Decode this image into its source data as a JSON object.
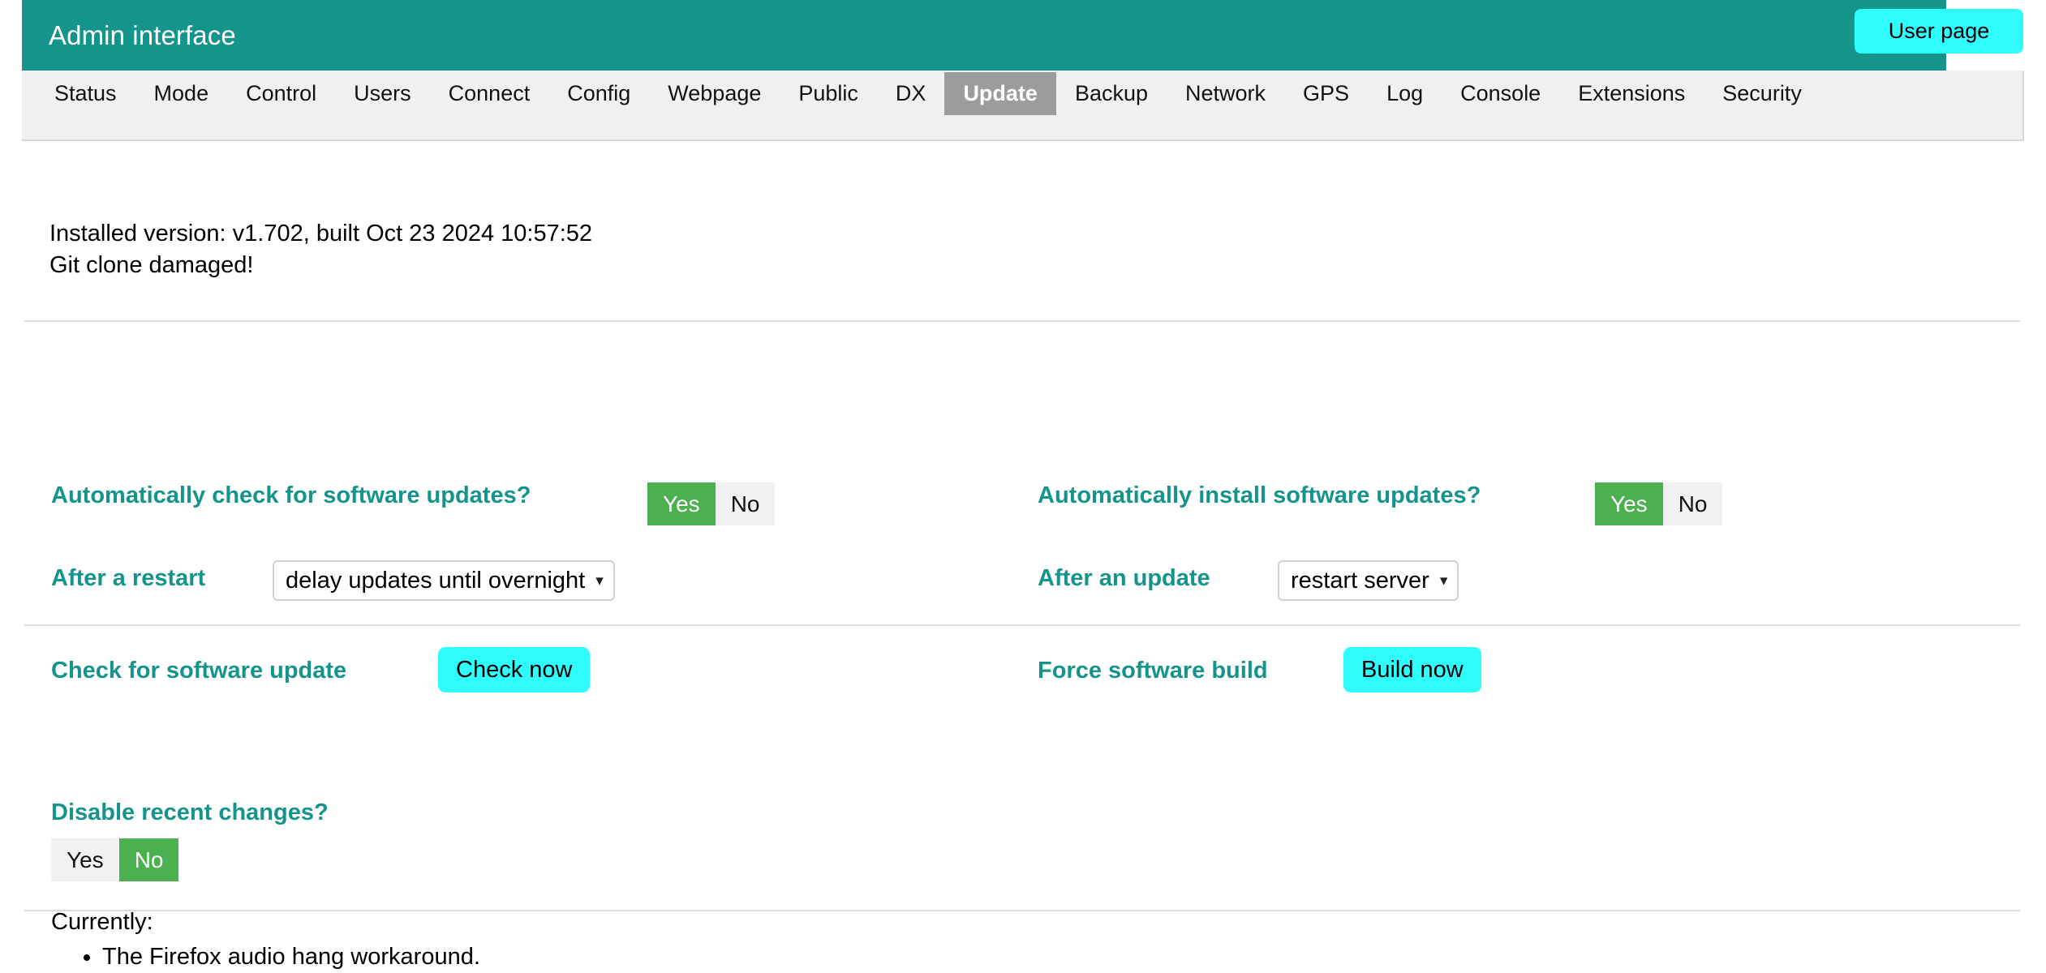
{
  "header": {
    "title": "Admin interface",
    "user_page_label": "User page"
  },
  "nav": {
    "items": [
      {
        "label": "Status",
        "active": false
      },
      {
        "label": "Mode",
        "active": false
      },
      {
        "label": "Control",
        "active": false
      },
      {
        "label": "Users",
        "active": false
      },
      {
        "label": "Connect",
        "active": false
      },
      {
        "label": "Config",
        "active": false
      },
      {
        "label": "Webpage",
        "active": false
      },
      {
        "label": "Public",
        "active": false
      },
      {
        "label": "DX",
        "active": false
      },
      {
        "label": "Update",
        "active": true
      },
      {
        "label": "Backup",
        "active": false
      },
      {
        "label": "Network",
        "active": false
      },
      {
        "label": "GPS",
        "active": false
      },
      {
        "label": "Log",
        "active": false
      },
      {
        "label": "Console",
        "active": false
      },
      {
        "label": "Extensions",
        "active": false
      },
      {
        "label": "Security",
        "active": false
      }
    ]
  },
  "version": {
    "installed": "Installed version: v1.702, built Oct 23 2024 10:57:52",
    "status": "Git clone damaged!"
  },
  "auto_check": {
    "label": "Automatically check for software updates?",
    "yes": "Yes",
    "no": "No",
    "selected": "Yes"
  },
  "auto_install": {
    "label": "Automatically install software updates?",
    "yes": "Yes",
    "no": "No",
    "selected": "Yes"
  },
  "after_restart": {
    "label": "After a restart",
    "value": "delay updates until overnight",
    "caret": "chevron-down"
  },
  "after_update": {
    "label": "After an update",
    "value": "restart server",
    "caret": "chevron-down"
  },
  "check_update": {
    "label": "Check for software update",
    "button": "Check now"
  },
  "force_build": {
    "label": "Force software build",
    "button": "Build now"
  },
  "disable_changes": {
    "label": "Disable recent changes?",
    "yes": "Yes",
    "no": "No",
    "selected": "No",
    "currently_label": "Currently:",
    "items": [
      "The Firefox audio hang workaround."
    ]
  },
  "colors": {
    "header_teal": "#15948b",
    "accent_cyan": "#2ffdfd",
    "toggle_green": "#4caf50",
    "label_teal": "#14948b",
    "nav_bg": "#f0f0f0",
    "nav_active": "#9c9c9c"
  }
}
